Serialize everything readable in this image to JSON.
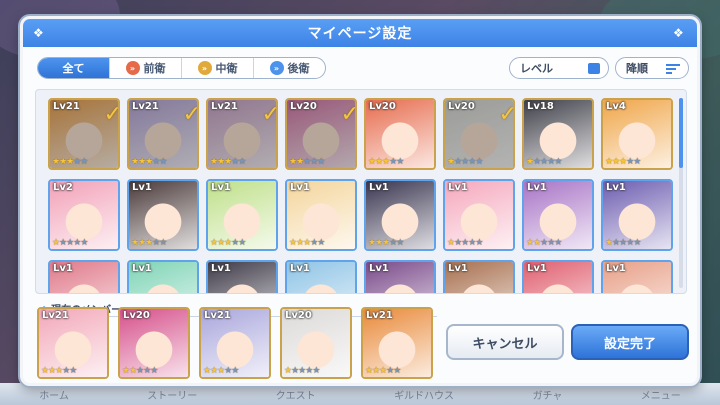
{
  "dialog": {
    "title": "マイページ設定"
  },
  "tabs": [
    {
      "label": "全て",
      "icon": "",
      "active": true
    },
    {
      "label": "前衛",
      "icon": "chevron-red-icon",
      "color": "#e66a4a",
      "active": false
    },
    {
      "label": "中衛",
      "icon": "chevron-yellow-icon",
      "color": "#e0a93a",
      "active": false
    },
    {
      "label": "後衛",
      "icon": "chevron-blue-icon",
      "color": "#4d93ee",
      "active": false
    }
  ],
  "sort": {
    "level_label": "レベル",
    "order_label": "降順"
  },
  "roster": [
    {
      "lv": "Lv21",
      "stars": 3,
      "selected": true,
      "frame": "gold",
      "hue": "#e9a04f"
    },
    {
      "lv": "Lv21",
      "stars": 3,
      "selected": true,
      "frame": "gold",
      "hue": "#b7a7d8"
    },
    {
      "lv": "Lv21",
      "stars": 3,
      "selected": true,
      "frame": "gold",
      "hue": "#c9a4c6"
    },
    {
      "lv": "Lv20",
      "stars": 2,
      "selected": true,
      "frame": "gold",
      "hue": "#d47aa8"
    },
    {
      "lv": "Lv20",
      "stars": 3,
      "selected": false,
      "frame": "gold",
      "hue": "#e76d4f"
    },
    {
      "lv": "Lv20",
      "stars": 1,
      "selected": true,
      "frame": "gold",
      "hue": "#d8d8d4"
    },
    {
      "lv": "Lv18",
      "stars": 1,
      "selected": false,
      "frame": "gold",
      "hue": "#40404a"
    },
    {
      "lv": "Lv4",
      "stars": 3,
      "selected": false,
      "frame": "gold",
      "hue": "#f0a64a"
    },
    {
      "lv": "Lv2",
      "stars": 1,
      "selected": false,
      "frame": "blue",
      "hue": "#f2a1b8"
    },
    {
      "lv": "Lv1",
      "stars": 3,
      "selected": false,
      "frame": "blue",
      "hue": "#4b3a3a"
    },
    {
      "lv": "Lv1",
      "stars": 3,
      "selected": false,
      "frame": "blue",
      "hue": "#bfe08a"
    },
    {
      "lv": "Lv1",
      "stars": 3,
      "selected": false,
      "frame": "blue",
      "hue": "#f4d59c"
    },
    {
      "lv": "Lv1",
      "stars": 3,
      "selected": false,
      "frame": "blue",
      "hue": "#3a3550"
    },
    {
      "lv": "Lv1",
      "stars": 1,
      "selected": false,
      "frame": "blue",
      "hue": "#f5a8bd"
    },
    {
      "lv": "Lv1",
      "stars": 2,
      "selected": false,
      "frame": "blue",
      "hue": "#a874c6"
    },
    {
      "lv": "Lv1",
      "stars": 1,
      "selected": false,
      "frame": "blue",
      "hue": "#6d5db0"
    },
    {
      "lv": "Lv1",
      "stars": 0,
      "selected": false,
      "frame": "blue",
      "hue": "#e07a8a"
    },
    {
      "lv": "Lv1",
      "stars": 0,
      "selected": false,
      "frame": "blue",
      "hue": "#7fd4b6"
    },
    {
      "lv": "Lv1",
      "stars": 0,
      "selected": false,
      "frame": "blue",
      "hue": "#3e3a48"
    },
    {
      "lv": "Lv1",
      "stars": 0,
      "selected": false,
      "frame": "blue",
      "hue": "#8fc4e6"
    },
    {
      "lv": "Lv1",
      "stars": 0,
      "selected": false,
      "frame": "blue",
      "hue": "#7a4a8a"
    },
    {
      "lv": "Lv1",
      "stars": 0,
      "selected": false,
      "frame": "blue",
      "hue": "#a8704f"
    },
    {
      "lv": "Lv1",
      "stars": 0,
      "selected": false,
      "frame": "blue",
      "hue": "#e06070"
    },
    {
      "lv": "Lv1",
      "stars": 0,
      "selected": false,
      "frame": "blue",
      "hue": "#e8a088"
    }
  ],
  "members": {
    "label": "現在のメンバー",
    "items": [
      {
        "lv": "Lv21",
        "stars": 3,
        "hue": "#f2a7b8"
      },
      {
        "lv": "Lv20",
        "stars": 2,
        "hue": "#d6508a"
      },
      {
        "lv": "Lv21",
        "stars": 3,
        "hue": "#a9a6dc"
      },
      {
        "lv": "Lv20",
        "stars": 1,
        "hue": "#dcdad8"
      },
      {
        "lv": "Lv21",
        "stars": 3,
        "hue": "#e98a3a"
      }
    ]
  },
  "buttons": {
    "cancel": "キャンセル",
    "confirm": "設定完了"
  },
  "bottom_nav": [
    "ホーム",
    "ストーリー",
    "クエスト",
    "ギルドハウス",
    "ガチャ",
    "メニュー"
  ]
}
